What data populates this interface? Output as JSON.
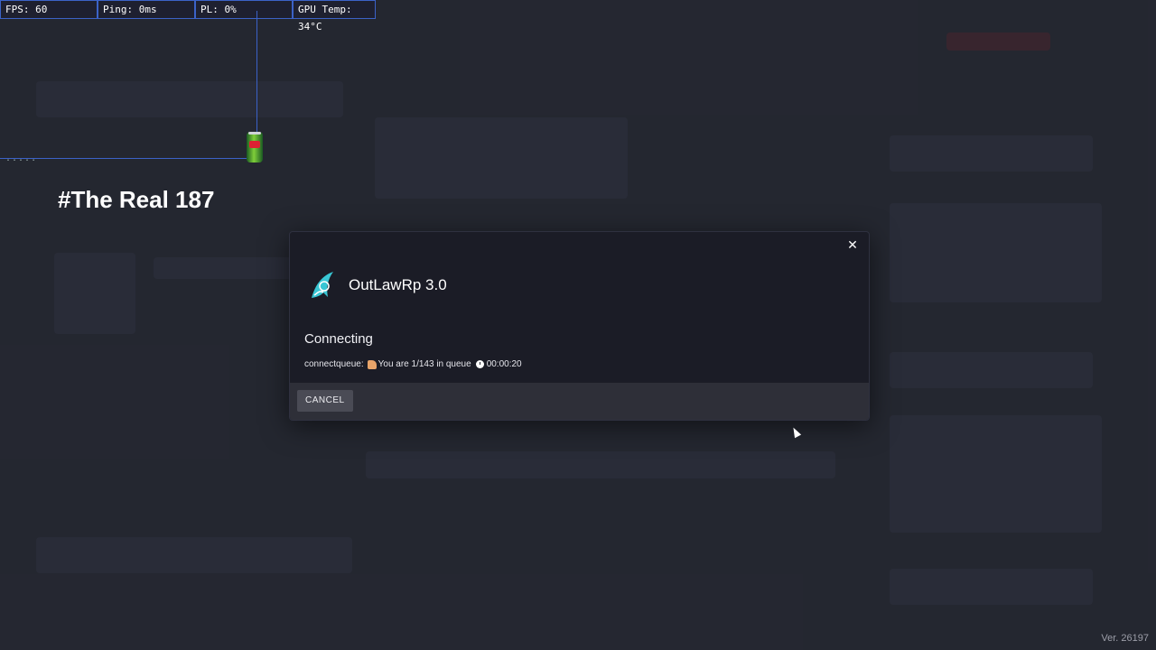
{
  "hud": {
    "fps": "FPS: 60",
    "ping": "Ping: 0ms",
    "pl": "PL: 0%",
    "gpu": "GPU Temp: 34°C"
  },
  "guide_dots": ".....",
  "overlay_title": "#The Real 187",
  "modal": {
    "server_name": "OutLawRp 3.0",
    "status": "Connecting",
    "queue_prefix": "connectqueue:",
    "queue_text": "You are 1/143 in queue",
    "queue_time": "00:00:20",
    "cancel_label": "CANCEL",
    "close_glyph": "✕"
  },
  "version": "Ver. 26197",
  "colors": {
    "modal_bg": "#1b1c26",
    "footer_bg": "#2e2f38",
    "accent": "#3b62c7",
    "logo_teal": "#39c6d4"
  },
  "icons": [
    "close-icon",
    "server-logo-icon",
    "hand-emoji-icon",
    "clock-icon",
    "mouse-cursor-icon",
    "soda-can-icon"
  ]
}
